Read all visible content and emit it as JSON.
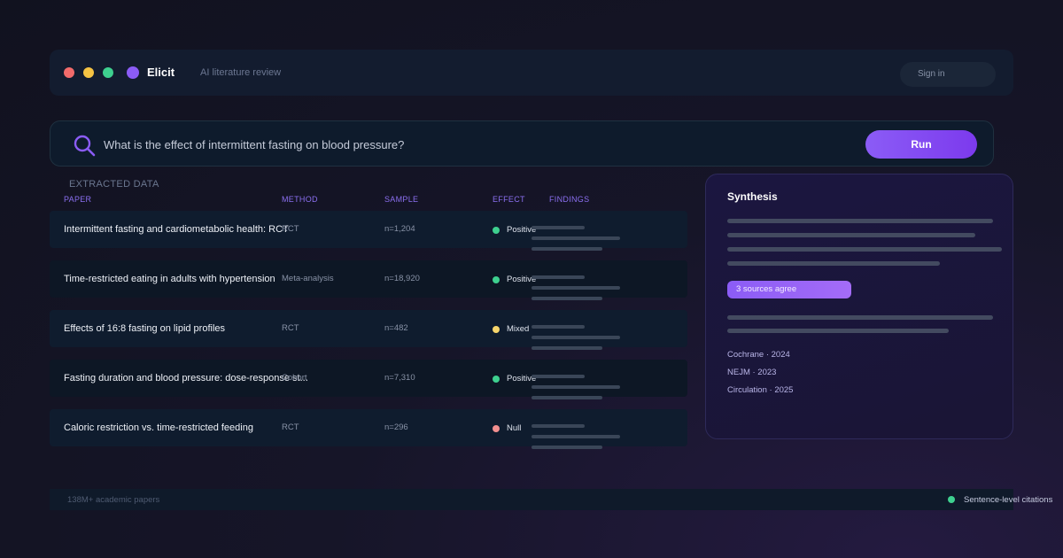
{
  "window": {
    "brand": "Elicit",
    "tagline": "AI literature review",
    "signin_label": "Sign in"
  },
  "search": {
    "query": "What is the effect of intermittent fasting on blood pressure?",
    "run_label": "Run"
  },
  "table": {
    "section_title": "EXTRACTED DATA",
    "columns": [
      "PAPER",
      "METHOD",
      "SAMPLE",
      "EFFECT",
      "FINDINGS"
    ],
    "rows": [
      {
        "title": "Intermittent fasting and cardiometabolic health: RCT",
        "method": "RCT",
        "sample": "n=1,204",
        "effect": "Positive",
        "effect_color": "#3ed08f"
      },
      {
        "title": "Time-restricted eating in adults with hypertension",
        "method": "Meta-analysis",
        "sample": "n=18,920",
        "effect": "Positive",
        "effect_color": "#3ed08f"
      },
      {
        "title": "Effects of 16:8 fasting on lipid profiles",
        "method": "RCT",
        "sample": "n=482",
        "effect": "Mixed",
        "effect_color": "#f6d56b"
      },
      {
        "title": "Fasting duration and blood pressure: dose-response st...",
        "method": "Cohort",
        "sample": "n=7,310",
        "effect": "Positive",
        "effect_color": "#3ed08f"
      },
      {
        "title": "Caloric restriction vs. time-restricted feeding",
        "method": "RCT",
        "sample": "n=296",
        "effect": "Null",
        "effect_color": "#f28f8f"
      }
    ]
  },
  "synthesis": {
    "title": "Synthesis",
    "badge": "3 sources agree",
    "sources": [
      "Cochrane · 2024",
      "NEJM · 2023",
      "Circulation · 2025"
    ]
  },
  "footer": {
    "left": "138M+ academic papers",
    "right": "Sentence-level citations"
  },
  "colors": {
    "accent": "#8b5cf6",
    "positive": "#3ed08f",
    "mixed": "#f6d56b",
    "null": "#f28f8f"
  }
}
